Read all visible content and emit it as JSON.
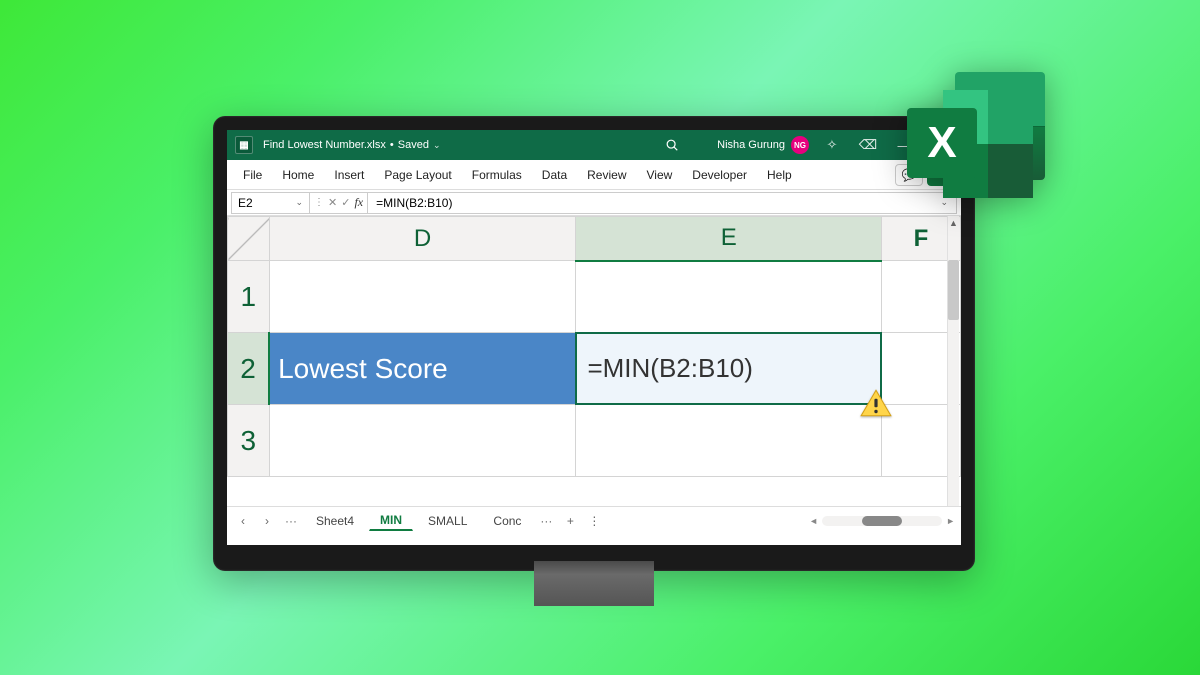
{
  "titlebar": {
    "filename": "Find Lowest Number.xlsx",
    "save_status": "Saved",
    "user_name": "Nisha Gurung",
    "user_initials": "NG"
  },
  "ribbon": {
    "tabs": [
      "File",
      "Home",
      "Insert",
      "Page Layout",
      "Formulas",
      "Data",
      "Review",
      "View",
      "Developer",
      "Help"
    ]
  },
  "formula_bar": {
    "cell_ref": "E2",
    "formula": "=MIN(B2:B10)"
  },
  "columns": {
    "D": "D",
    "E": "E",
    "F": "F"
  },
  "rows": {
    "r1": "1",
    "r2": "2",
    "r3": "3"
  },
  "cells": {
    "D2": "Lowest Score",
    "E2": "=MIN(B2:B10)"
  },
  "sheets": {
    "items": [
      "Sheet4",
      "MIN",
      "SMALL",
      "Conc"
    ],
    "active": "MIN"
  },
  "logo": {
    "letter": "X"
  },
  "icons": {
    "dot": "•",
    "chev_down": "⌄",
    "search": "🔍",
    "diamond": "✧",
    "eraser": "⌫",
    "minimize": "—",
    "restore": "▢",
    "comment": "💬",
    "share_chev": "⌄",
    "cancel": "✕",
    "enter": "✓",
    "more": "···",
    "plus": "+",
    "dots": "⋮",
    "left": "◄",
    "right": "►",
    "up": "▲"
  }
}
